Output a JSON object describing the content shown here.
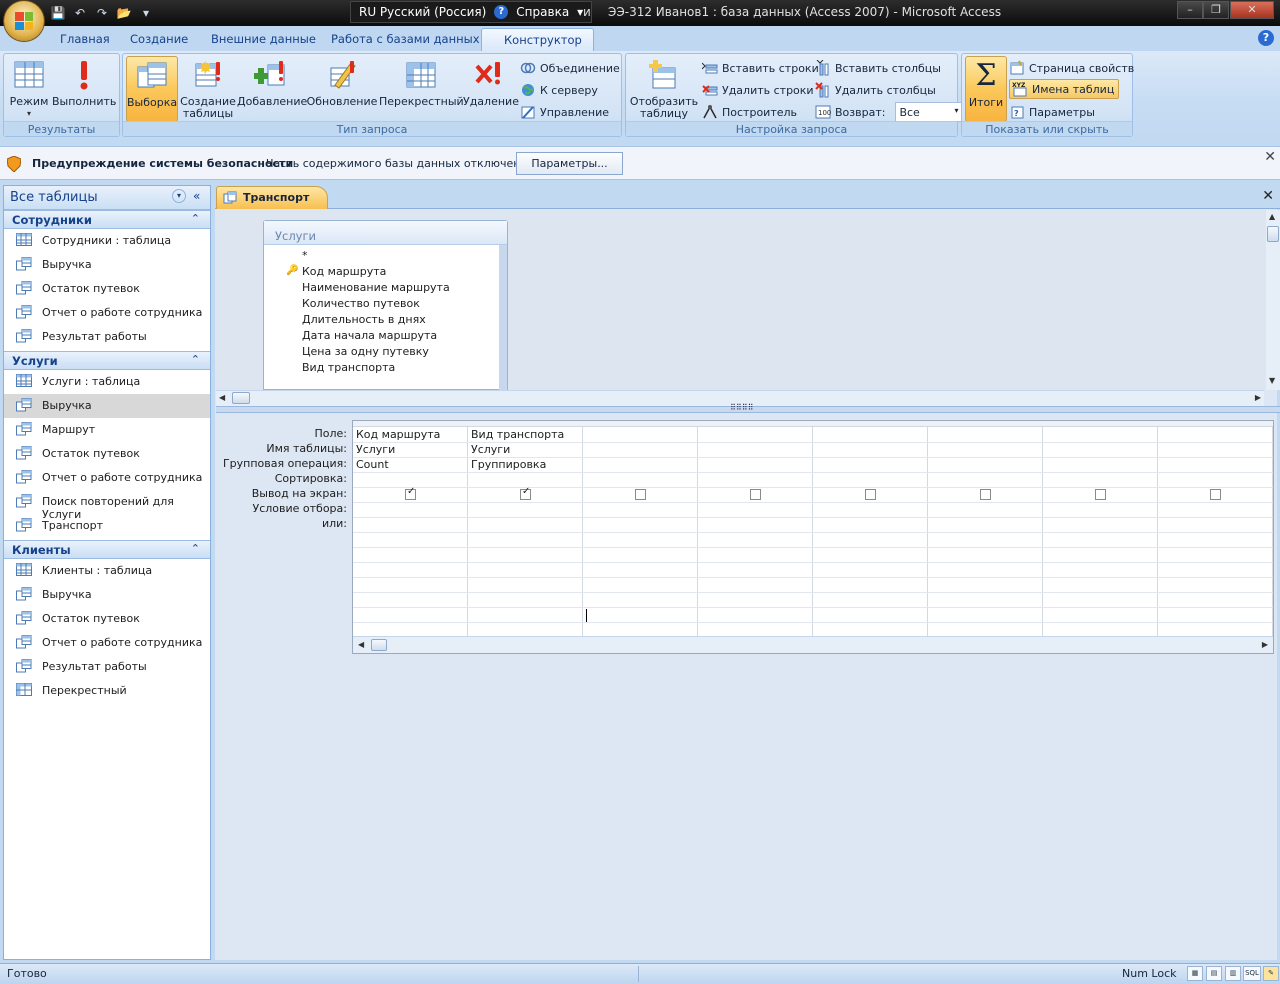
{
  "window": {
    "title": "ЭЭ-312 Иванов1 : база данных (Access 2007) - Microsoft Access",
    "language": "RU Русский (Россия)",
    "help_label": "Справка",
    "title_fragment": "и"
  },
  "tabs": [
    "Главная",
    "Создание",
    "Внешние данные",
    "Работа с базами данных",
    "Конструктор"
  ],
  "active_tab": "Конструктор",
  "ribbon": {
    "results": {
      "caption": "Результаты",
      "mode": "Режим",
      "run": "Выполнить"
    },
    "query_type": {
      "caption": "Тип запроса",
      "select": "Выборка",
      "make_table_1": "Создание",
      "make_table_2": "таблицы",
      "append": "Добавление",
      "update": "Обновление",
      "crosstab": "Перекрестный",
      "delete": "Удаление",
      "union": "Объединение",
      "pass_through": "К серверу",
      "data_definition": "Управление"
    },
    "query_setup": {
      "caption": "Настройка запроса",
      "show_table_1": "Отобразить",
      "show_table_2": "таблицу",
      "insert_rows": "Вставить строки",
      "delete_rows": "Удалить строки",
      "builder": "Построитель",
      "insert_columns": "Вставить столбцы",
      "delete_columns": "Удалить столбцы",
      "return_label": "Возврат:",
      "return_value": "Все"
    },
    "show_hide": {
      "caption": "Показать или скрыть",
      "totals": "Итоги",
      "property_sheet": "Страница свойств",
      "table_names": "Имена таблиц",
      "parameters": "Параметры"
    }
  },
  "security_bar": {
    "title": "Предупреждение системы безопасности",
    "text": "Часть содержимого базы данных отключено",
    "button": "Параметры..."
  },
  "nav": {
    "header": "Все таблицы",
    "groups": [
      {
        "name": "Сотрудники",
        "items": [
          {
            "label": "Сотрудники : таблица",
            "icon": "table-icon"
          },
          {
            "label": "Выручка",
            "icon": "query-icon"
          },
          {
            "label": "Остаток путевок",
            "icon": "query-icon"
          },
          {
            "label": "Отчет о работе сотрудника",
            "icon": "query-icon"
          },
          {
            "label": "Результат работы",
            "icon": "query-icon"
          }
        ]
      },
      {
        "name": "Услуги",
        "items": [
          {
            "label": "Услуги : таблица",
            "icon": "table-icon"
          },
          {
            "label": "Выручка",
            "icon": "query-icon",
            "selected": true
          },
          {
            "label": "Маршрут",
            "icon": "query-icon"
          },
          {
            "label": "Остаток путевок",
            "icon": "query-icon"
          },
          {
            "label": "Отчет о работе сотрудника",
            "icon": "query-icon"
          },
          {
            "label": "Поиск повторений для Услуги",
            "icon": "query-icon"
          },
          {
            "label": "Транспорт",
            "icon": "query-icon"
          }
        ]
      },
      {
        "name": "Клиенты",
        "items": [
          {
            "label": "Клиенты : таблица",
            "icon": "table-icon"
          },
          {
            "label": "Выручка",
            "icon": "query-icon"
          },
          {
            "label": "Остаток путевок",
            "icon": "query-icon"
          },
          {
            "label": "Отчет о работе сотрудника",
            "icon": "query-icon"
          },
          {
            "label": "Результат работы",
            "icon": "query-icon"
          },
          {
            "label": "Перекрестный",
            "icon": "crosstab-icon"
          }
        ]
      }
    ]
  },
  "document": {
    "tab_title": "Транспорт",
    "field_list": {
      "table": "Услуги",
      "fields": [
        "*",
        "Код маршрута",
        "Наименование маршрута",
        "Количество путевок",
        "Длительность в днях",
        "Дата начала маршрута",
        "Цена за одну путевку",
        "Вид транспорта"
      ],
      "key_field": "Код маршрута"
    },
    "grid": {
      "row_labels": [
        "Поле:",
        "Имя таблицы:",
        "Групповая операция:",
        "Сортировка:",
        "Вывод на экран:",
        "Условие отбора:",
        "или:"
      ],
      "columns": [
        {
          "field": "Код маршрута",
          "table": "Услуги",
          "total": "Count",
          "show": true
        },
        {
          "field": "Вид транспорта",
          "table": "Услуги",
          "total": "Группировка",
          "show": true
        },
        {
          "field": "",
          "table": "",
          "total": "",
          "show": false
        },
        {
          "field": "",
          "table": "",
          "total": "",
          "show": false
        },
        {
          "field": "",
          "table": "",
          "total": "",
          "show": false
        },
        {
          "field": "",
          "table": "",
          "total": "",
          "show": false
        },
        {
          "field": "",
          "table": "",
          "total": "",
          "show": false
        },
        {
          "field": "",
          "table": "",
          "total": "",
          "show": false
        }
      ]
    }
  },
  "status": {
    "left": "Готово",
    "num_lock": "Num Lock",
    "view_sql": "SQL"
  },
  "colors": {
    "accent": "#f8bf50",
    "ribbon": "#c6dcf3",
    "selected": "#d8d8d8"
  }
}
